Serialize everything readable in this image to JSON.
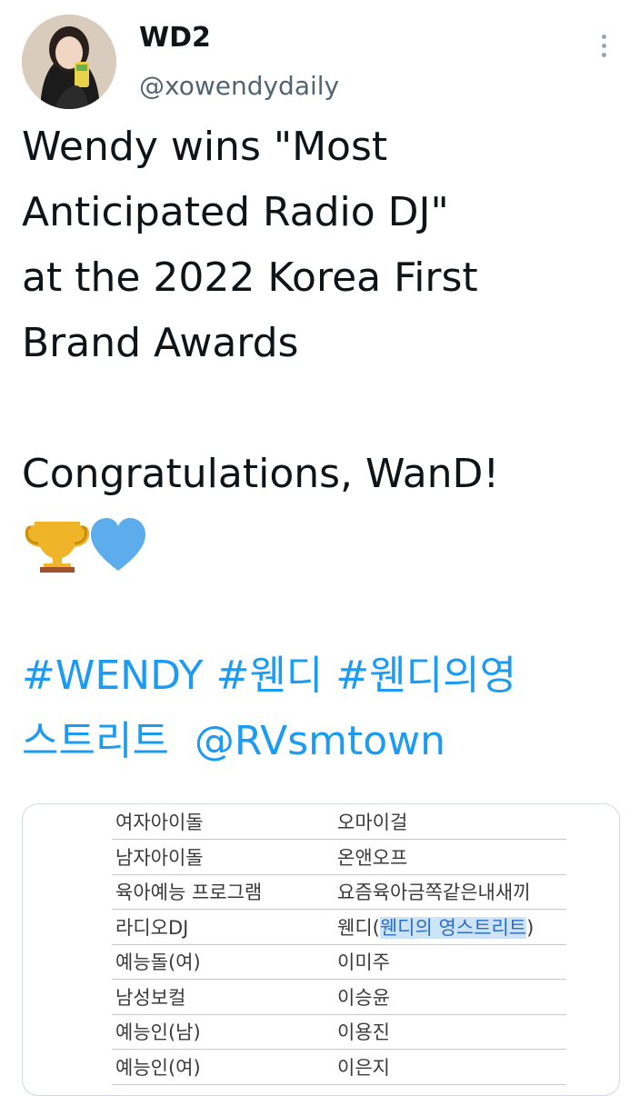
{
  "user": {
    "name": "WD2",
    "handle": "@xowendydaily"
  },
  "tweet": {
    "text": "Wendy wins \"Most\nAnticipated Radio DJ\"\nat the 2022 Korea First\nBrand Awards\n\nCongratulations, WanD!",
    "emojis": [
      "trophy-emoji",
      "blue-heart-emoji"
    ],
    "tags": [
      "#WENDY",
      "#웬디",
      "#웬디의영",
      "스트리트",
      "@RVsmtown"
    ]
  },
  "colors": {
    "link": "#1d9bf0",
    "handle": "#536471",
    "text": "#0f1419"
  },
  "table": {
    "rows": [
      {
        "category": "여자아이돌",
        "winner": "오마이걸"
      },
      {
        "category": "남자아이돌",
        "winner": "온앤오프"
      },
      {
        "category": "육아예능 프로그램",
        "winner": "요즘육아금쪽같은내새끼"
      },
      {
        "category": "라디오DJ",
        "winner": "웬디",
        "winner_note": "웬디의 영스트리트"
      },
      {
        "category": "예능돌(여)",
        "winner": "이미주"
      },
      {
        "category": "남성보컬",
        "winner": "이승윤"
      },
      {
        "category": "예능인(남)",
        "winner": "이용진"
      },
      {
        "category": "예능인(여)",
        "winner": "이은지"
      }
    ]
  }
}
